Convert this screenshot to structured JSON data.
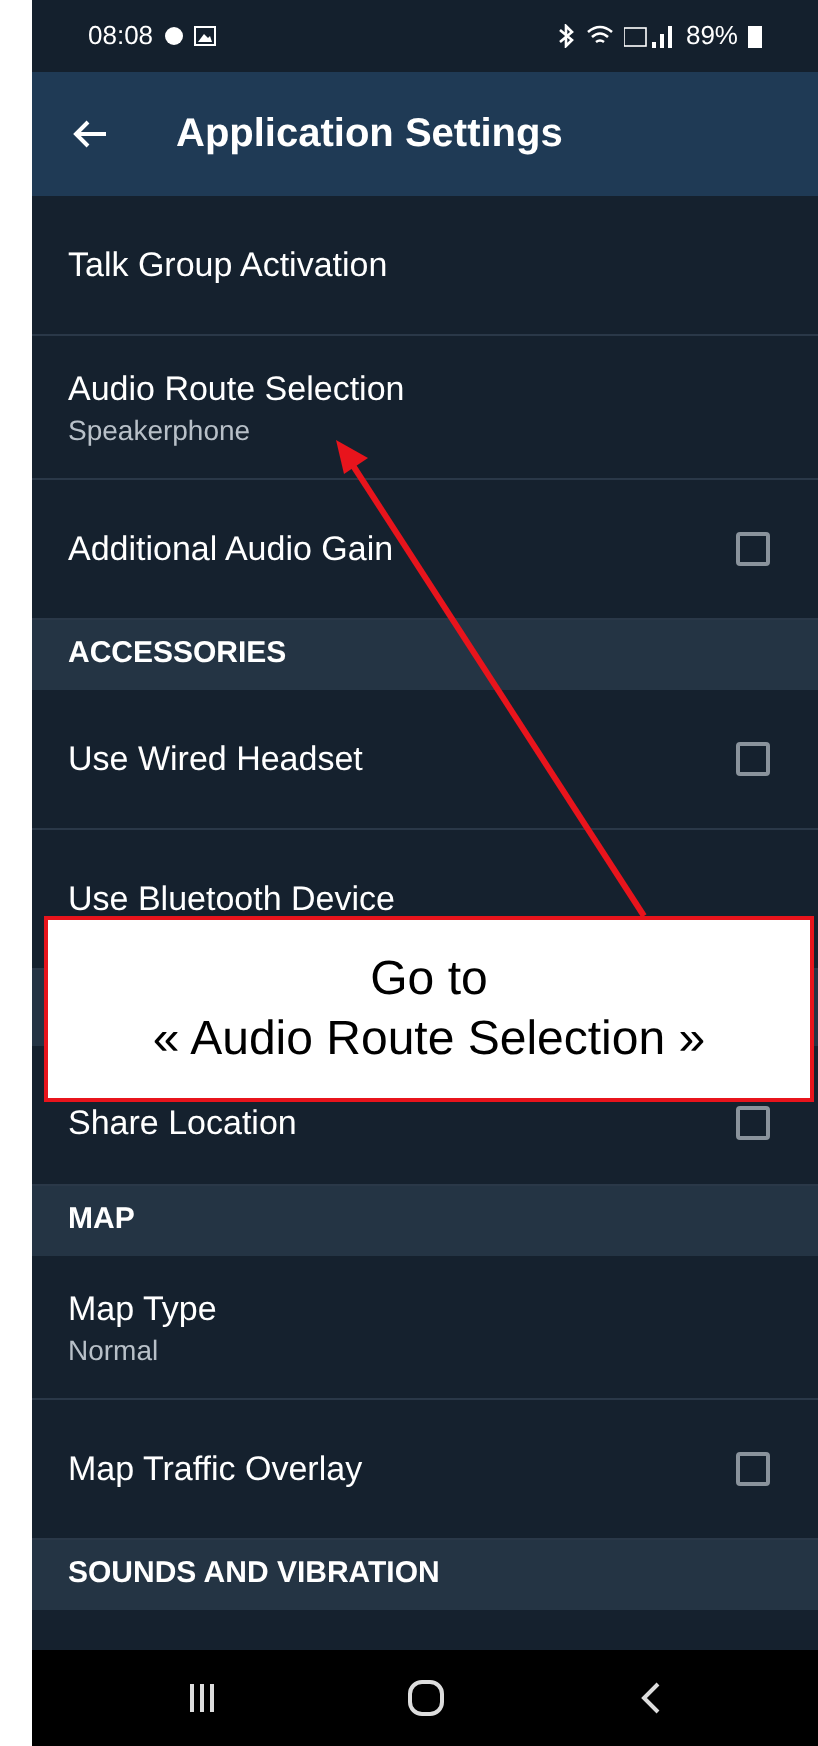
{
  "status_bar": {
    "time": "08:08",
    "battery": "89%"
  },
  "app_bar": {
    "title": "Application Settings"
  },
  "items": [
    {
      "kind": "setting",
      "label": "Talk Group Activation"
    },
    {
      "kind": "setting",
      "label": "Audio Route Selection",
      "value": "Speakerphone"
    },
    {
      "kind": "setting",
      "label": "Additional Audio Gain",
      "checked": false
    },
    {
      "kind": "header",
      "label": "ACCESSORIES"
    },
    {
      "kind": "setting",
      "label": "Use Wired Headset",
      "checked": false
    },
    {
      "kind": "setting",
      "label": "Use Bluetooth Device"
    },
    {
      "kind": "header"
    },
    {
      "kind": "setting",
      "label": "Share Location",
      "checked": false
    },
    {
      "kind": "header",
      "label": "MAP"
    },
    {
      "kind": "setting",
      "label": "Map Type",
      "value": "Normal"
    },
    {
      "kind": "setting",
      "label": "Map Traffic Overlay",
      "checked": false
    },
    {
      "kind": "header",
      "label": "SOUNDS AND VIBRATION"
    },
    {
      "kind": "partial"
    }
  ],
  "callout": {
    "lines": [
      "Go to",
      "« Audio Route Selection »"
    ]
  }
}
